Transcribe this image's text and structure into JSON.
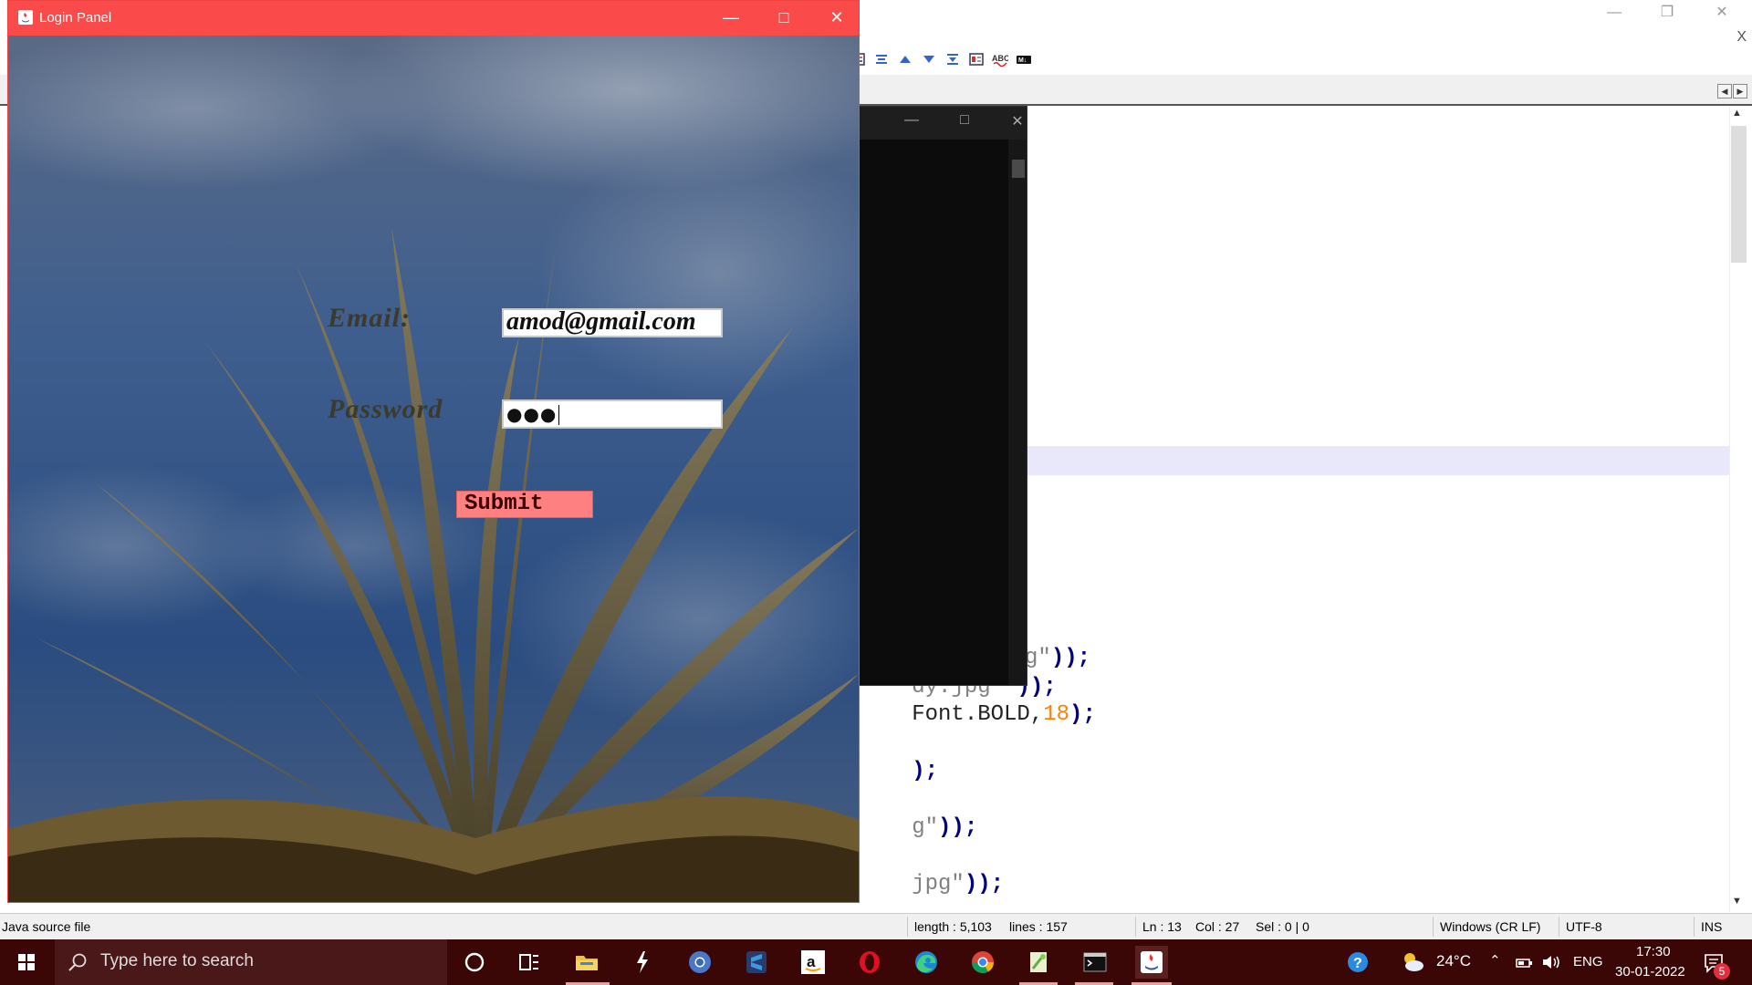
{
  "editor": {
    "close_x": "X",
    "code_lines": [
      {
        "str": "g\"",
        "op": "));",
        "rest": ""
      },
      {
        "str": "_body.jpg \"",
        "op": "));",
        "rest": ""
      },
      {
        "pre": "e\",Font.BOLD,",
        "num": "18",
        "op2": ");"
      },
      {
        "str": "g\"",
        "op": "));",
        "rest": ""
      },
      {
        "str": ".jpg\"",
        "op": "));",
        "rest": ""
      },
      {
        "str": "ut.jpg\"",
        "op": "));",
        "rest": ""
      }
    ],
    "statusbar": {
      "file_type": "Java source file",
      "length": "length : 5,103",
      "lines": "lines : 157",
      "ln": "Ln : 13",
      "col": "Col : 27",
      "sel": "Sel : 0 | 0",
      "eol": "Windows (CR LF)",
      "encoding": "UTF-8",
      "mode": "INS"
    }
  },
  "login_window": {
    "title": "Login Panel",
    "email_label": "Email:",
    "email_value": "amod@gmail.com",
    "password_label": "Password",
    "password_value": "●●●",
    "submit_label": "Submit"
  },
  "taskbar": {
    "search_placeholder": "Type here to search",
    "apps": [
      "cortana-icon",
      "task-view-icon",
      "file-explorer-icon",
      "winscp-icon",
      "chrome-canary-icon",
      "sublime-icon",
      "amazon-icon",
      "opera-icon",
      "edge-icon",
      "chrome-icon",
      "notepad-plus-icon",
      "terminal-icon",
      "java-icon"
    ],
    "weather": "24°C",
    "language": "ENG",
    "time": "17:30",
    "date": "30-01-2022",
    "notification_count": "5"
  },
  "colors": {
    "login_titlebar": "#fa4a4a",
    "submit_bg": "#ff8080",
    "taskbar_bg": "#3a0606"
  }
}
